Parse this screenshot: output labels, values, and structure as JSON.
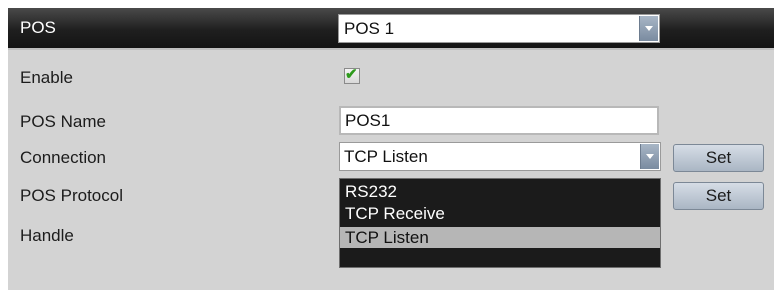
{
  "header": {
    "label": "POS",
    "pos_select_value": "POS 1"
  },
  "fields": {
    "enable_label": "Enable",
    "enable_checked": true,
    "pos_name_label": "POS Name",
    "pos_name_value": "POS1",
    "connection_label": "Connection",
    "connection_value": "TCP Listen",
    "protocol_label": "POS Protocol",
    "handle_label": "Handle"
  },
  "buttons": {
    "connection_set": "Set",
    "protocol_set": "Set"
  },
  "connection_dropdown": {
    "options": [
      "RS232",
      "TCP Receive",
      "TCP Listen"
    ],
    "selected": "TCP Listen"
  },
  "icons": {
    "checkmark": "✔",
    "dropdown_arrow": "chevron-down-icon"
  }
}
